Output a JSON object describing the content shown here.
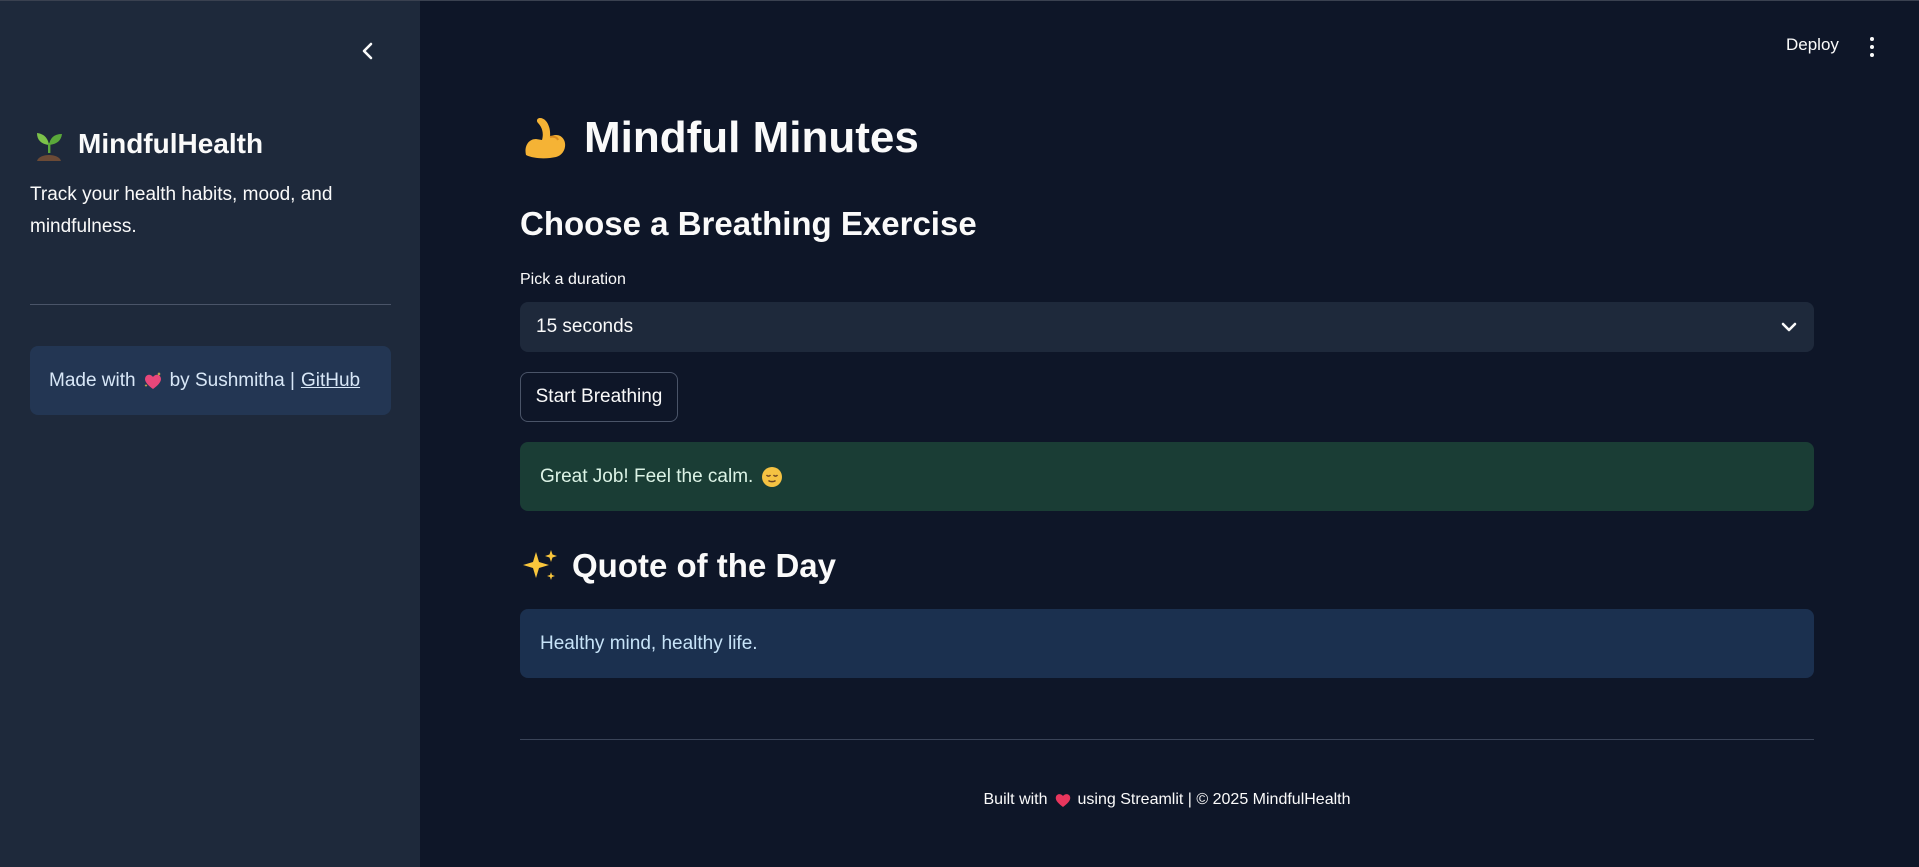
{
  "sidebar": {
    "brand_name": "MindfulHealth",
    "brand_icon": "seedling-icon",
    "tagline": "Track your health habits, mood, and mindfulness.",
    "credit": {
      "prefix": "Made with",
      "icon": "sparkling-heart-icon",
      "by_text": "by Sushmitha |",
      "link_label": "GitHub"
    }
  },
  "header": {
    "deploy_label": "Deploy",
    "menu_icon": "kebab-menu-icon"
  },
  "main": {
    "title": "Mindful Minutes",
    "title_icon": "flexed-biceps-icon",
    "subtitle": "Choose a Breathing Exercise",
    "duration": {
      "label": "Pick a duration",
      "selected": "15 seconds"
    },
    "start_button_label": "Start Breathing",
    "success_message": "Great Job! Feel the calm.",
    "success_icon": "relieved-face-icon",
    "quote_heading": "Quote of the Day",
    "quote_icon": "sparkles-icon",
    "quote_text": "Healthy mind, healthy life.",
    "footer": {
      "prefix": "Built with",
      "icon": "heart-icon",
      "suffix": "using Streamlit | © 2025 MindfulHealth"
    }
  },
  "colors": {
    "app_background": "#0e1628",
    "sidebar_background": "#1e293b",
    "success_background": "#1a3d35",
    "info_background": "#1b304f",
    "credit_background": "#233653"
  }
}
